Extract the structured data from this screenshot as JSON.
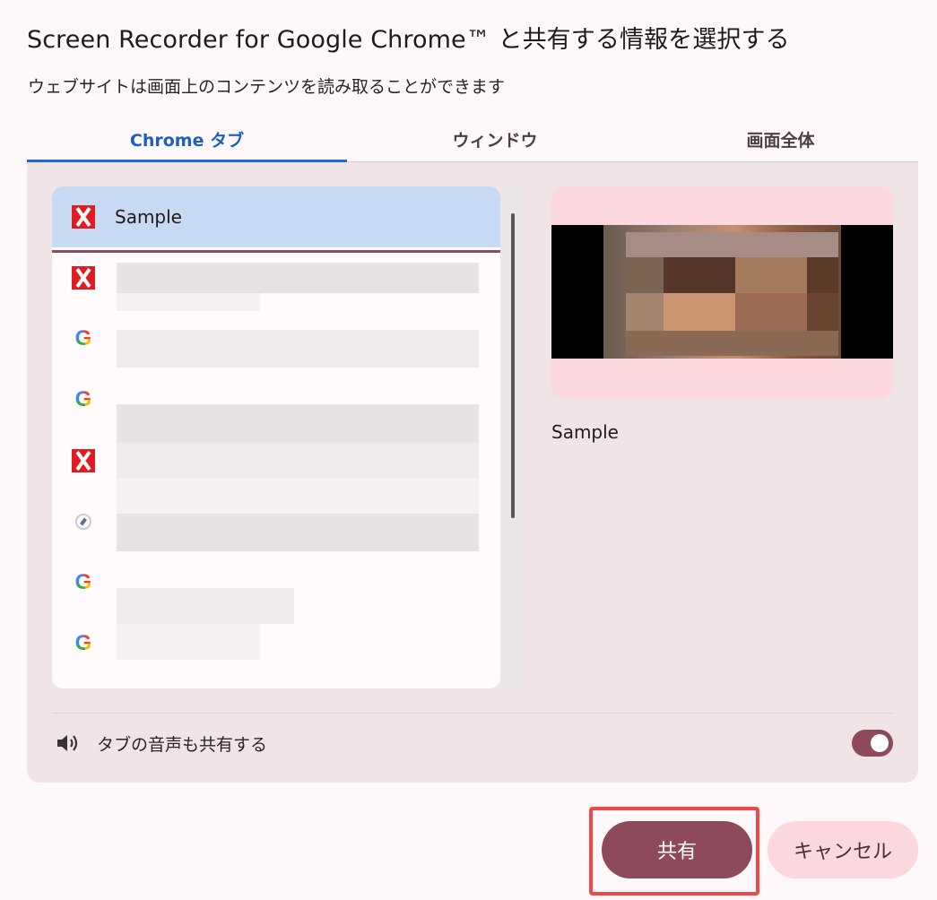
{
  "dialog": {
    "title": "Screen Recorder for Google Chrome™ と共有する情報を選択する",
    "subtitle": "ウェブサイトは画面上のコンテンツを読み取ることができます"
  },
  "tabs": [
    {
      "label": "Chrome タブ",
      "active": true
    },
    {
      "label": "ウィンドウ",
      "active": false
    },
    {
      "label": "画面全体",
      "active": false
    }
  ],
  "tab_list": {
    "items": [
      {
        "icon": "x-icon",
        "label": "Sample",
        "selected": true
      },
      {
        "icon": "x-icon",
        "label": "",
        "selected": false
      },
      {
        "icon": "google-icon",
        "label": "",
        "selected": false
      },
      {
        "icon": "google-icon",
        "label": "",
        "selected": false
      },
      {
        "icon": "x-icon",
        "label": "",
        "selected": false
      },
      {
        "icon": "compass-icon",
        "label": "",
        "selected": false
      },
      {
        "icon": "google-icon",
        "label": "",
        "selected": false
      },
      {
        "icon": "google-icon",
        "label": "",
        "selected": false
      }
    ]
  },
  "preview": {
    "label": "Sample"
  },
  "audio": {
    "label": "タブの音声も共有する",
    "enabled": true
  },
  "buttons": {
    "share": "共有",
    "cancel": "キャンセル"
  },
  "colors": {
    "accent": "#8c4a5a",
    "active_tab": "#1f6ccc",
    "highlight_outline": "#f04848"
  }
}
